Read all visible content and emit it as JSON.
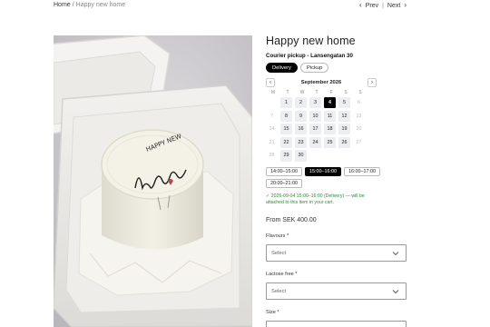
{
  "breadcrumb": {
    "home": "Home",
    "separator": "/",
    "current": "Happy new home"
  },
  "pager": {
    "prev": "Prev",
    "divider": "|",
    "next": "Next"
  },
  "product": {
    "title": "Happy new home",
    "image_alt": "Bento cake in a white takeaway box with Happy new home script topper",
    "topper_text": "HAPPY NEW home"
  },
  "delivery": {
    "pickup_location": "Courier pickup - Lansengatan 30",
    "modes": [
      {
        "label": "Delivery",
        "active": true
      },
      {
        "label": "Pickup",
        "active": false
      }
    ]
  },
  "calendar": {
    "month": "September 2026",
    "prev_icon": "‹",
    "next_icon": "›",
    "weekdays": [
      "M",
      "T",
      "W",
      "T",
      "F",
      "S",
      "S"
    ],
    "days": [
      {
        "label": "",
        "state": "blank"
      },
      {
        "label": "1",
        "state": "avail"
      },
      {
        "label": "2",
        "state": "avail"
      },
      {
        "label": "3",
        "state": "avail"
      },
      {
        "label": "4",
        "state": "selected"
      },
      {
        "label": "5",
        "state": "avail"
      },
      {
        "label": "6",
        "state": "muted"
      },
      {
        "label": "7",
        "state": "muted"
      },
      {
        "label": "8",
        "state": "avail"
      },
      {
        "label": "9",
        "state": "avail"
      },
      {
        "label": "10",
        "state": "avail"
      },
      {
        "label": "11",
        "state": "avail"
      },
      {
        "label": "12",
        "state": "avail"
      },
      {
        "label": "13",
        "state": "muted"
      },
      {
        "label": "14",
        "state": "muted"
      },
      {
        "label": "15",
        "state": "avail"
      },
      {
        "label": "16",
        "state": "avail"
      },
      {
        "label": "17",
        "state": "avail"
      },
      {
        "label": "18",
        "state": "avail"
      },
      {
        "label": "19",
        "state": "avail"
      },
      {
        "label": "20",
        "state": "muted"
      },
      {
        "label": "21",
        "state": "muted"
      },
      {
        "label": "22",
        "state": "avail"
      },
      {
        "label": "23",
        "state": "avail"
      },
      {
        "label": "24",
        "state": "avail"
      },
      {
        "label": "25",
        "state": "avail"
      },
      {
        "label": "26",
        "state": "avail"
      },
      {
        "label": "27",
        "state": "muted"
      },
      {
        "label": "28",
        "state": "muted"
      },
      {
        "label": "29",
        "state": "avail"
      },
      {
        "label": "30",
        "state": "avail"
      }
    ]
  },
  "time_slots": [
    {
      "label": "14:00–15:00",
      "active": false
    },
    {
      "label": "15:00–16:00",
      "active": true
    },
    {
      "label": "16:00–17:00",
      "active": false
    },
    {
      "label": "20:00–21:00",
      "active": false
    }
  ],
  "confirmation": "✓ 2026-09-04 15:00–16:00 (Delivery) — will be attached to this item in your cart.",
  "price": "From SEK 400.00",
  "options": [
    {
      "label": "Flavours *",
      "value": "Select"
    },
    {
      "label": "Lactose free *",
      "value": "Select"
    },
    {
      "label": "Size *",
      "value": "Select"
    }
  ],
  "colors": {
    "accent": "#000000",
    "confirm_text": "#2e8b3a",
    "available_day": "#eceef2"
  }
}
